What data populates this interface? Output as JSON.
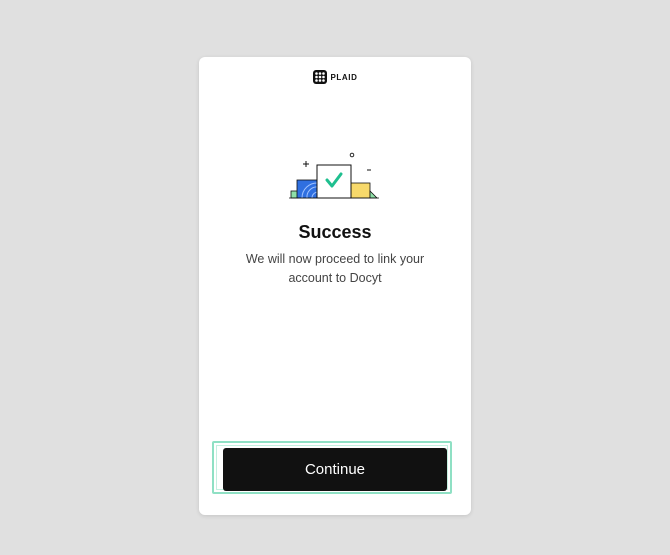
{
  "brand": {
    "name": "PLAID",
    "logo_icon": "plaid-logo-icon"
  },
  "illustration": {
    "icon": "success-checkmark-illustration"
  },
  "content": {
    "title": "Success",
    "message": "We will now proceed to link your account to Docyt"
  },
  "actions": {
    "continue_label": "Continue"
  },
  "colors": {
    "background": "#e0e0e0",
    "card": "#ffffff",
    "button": "#111111",
    "button_text": "#ffffff",
    "focus_ring": "#8fe0c4",
    "check": "#1fbf8f",
    "blue": "#2f6fe0",
    "yellow": "#f7d96b",
    "green": "#8fe0a8"
  }
}
